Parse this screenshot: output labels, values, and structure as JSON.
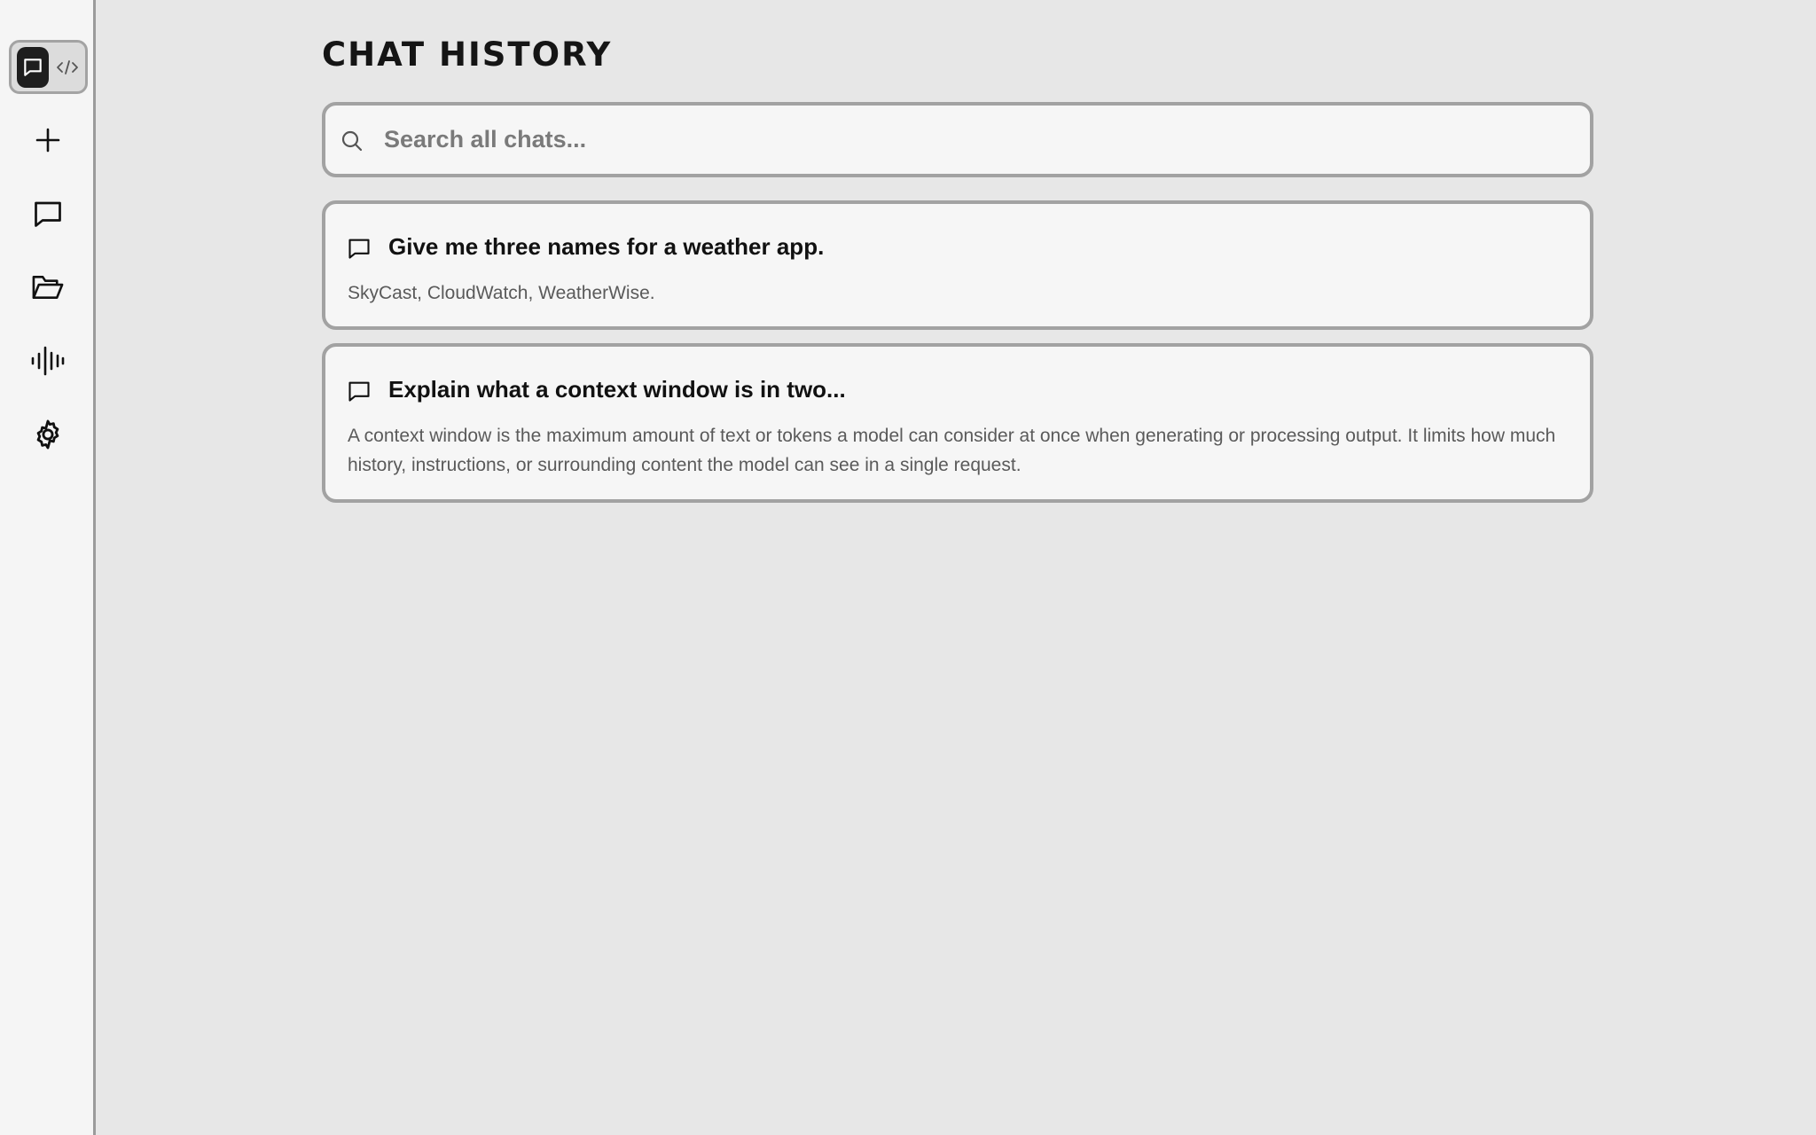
{
  "sidebar": {
    "mode_toggle": {
      "options": [
        {
          "name": "chat-mode",
          "icon": "chat-bubble-icon",
          "selected": true
        },
        {
          "name": "code-mode",
          "icon": "code-brackets-icon",
          "selected": false
        }
      ]
    },
    "items": [
      {
        "name": "new-chat",
        "icon": "plus-icon"
      },
      {
        "name": "chats",
        "icon": "chat-bubble-icon"
      },
      {
        "name": "projects",
        "icon": "folder-open-icon"
      },
      {
        "name": "voice",
        "icon": "audio-waveform-icon"
      },
      {
        "name": "settings",
        "icon": "gear-icon"
      }
    ]
  },
  "main": {
    "title": "CHAT HISTORY",
    "search": {
      "placeholder": "Search all chats...",
      "value": ""
    },
    "chats": [
      {
        "title": "Give me three names for a weather app.",
        "preview": "SkyCast, CloudWatch, WeatherWise."
      },
      {
        "title": "Explain what a context window is in two...",
        "preview": "A context window is the maximum amount of text or tokens a model can consider at once when generating or processing output. It limits how much history, instructions, or surrounding content the model can see in a single request."
      }
    ]
  },
  "colors": {
    "background": "#e7e7e7",
    "sidebar_background": "#f5f5f5",
    "card_background": "#f6f6f6",
    "border": "#a2a2a2",
    "active_mode": "#1e1e1e",
    "text_primary": "#111111",
    "text_secondary": "#5a5a5a"
  }
}
